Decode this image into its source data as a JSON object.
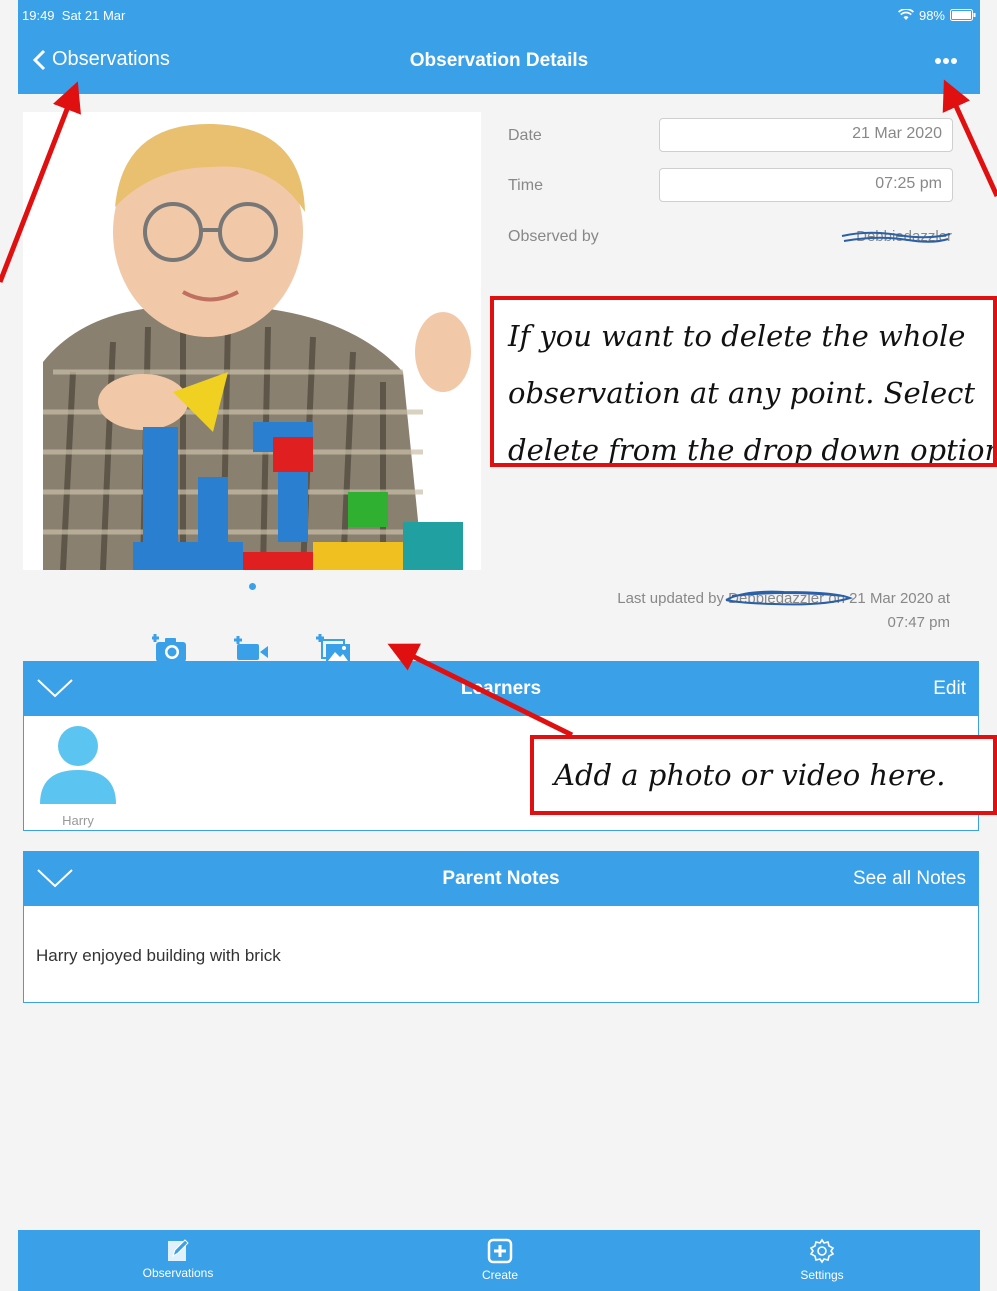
{
  "status_bar": {
    "time": "19:49",
    "date": "Sat 21 Mar",
    "battery": "98%"
  },
  "nav": {
    "back_label": "Observations",
    "title": "Observation Details"
  },
  "details": {
    "date_label": "Date",
    "date_value": "21 Mar 2020",
    "time_label": "Time",
    "time_value": "07:25 pm",
    "observed_by_label": "Observed by",
    "observed_by_value": "Debbiedazzler"
  },
  "last_updated": {
    "prefix": "Last updated by",
    "user": "Debbiedazzler",
    "middle": "on 21 Mar 2020 at",
    "time": "07:47 pm"
  },
  "learners": {
    "title": "Learners",
    "action": "Edit",
    "items": [
      {
        "name": "Harry"
      }
    ]
  },
  "parent_notes": {
    "title": "Parent Notes",
    "action": "See all Notes",
    "text": "Harry enjoyed building with brick"
  },
  "tab_bar": {
    "items": [
      {
        "label": "Observations"
      },
      {
        "label": "Create"
      },
      {
        "label": "Settings"
      }
    ]
  },
  "callouts": {
    "delete_lines": [
      "If you want to delete the whole",
      "observation at any point. Select",
      "delete from the drop down options"
    ],
    "media": "Add a photo or video here."
  },
  "colors": {
    "accent": "#3aa0e8",
    "annotation": "#e01010",
    "background": "#f4f4f4"
  },
  "icons": [
    "wifi-icon",
    "battery-icon",
    "back-chevron-icon",
    "more-icon",
    "camera-icon",
    "video-icon",
    "gallery-icon",
    "collapse-chevron-icon",
    "avatar-icon",
    "pencil-icon",
    "plus-icon",
    "gear-icon"
  ]
}
